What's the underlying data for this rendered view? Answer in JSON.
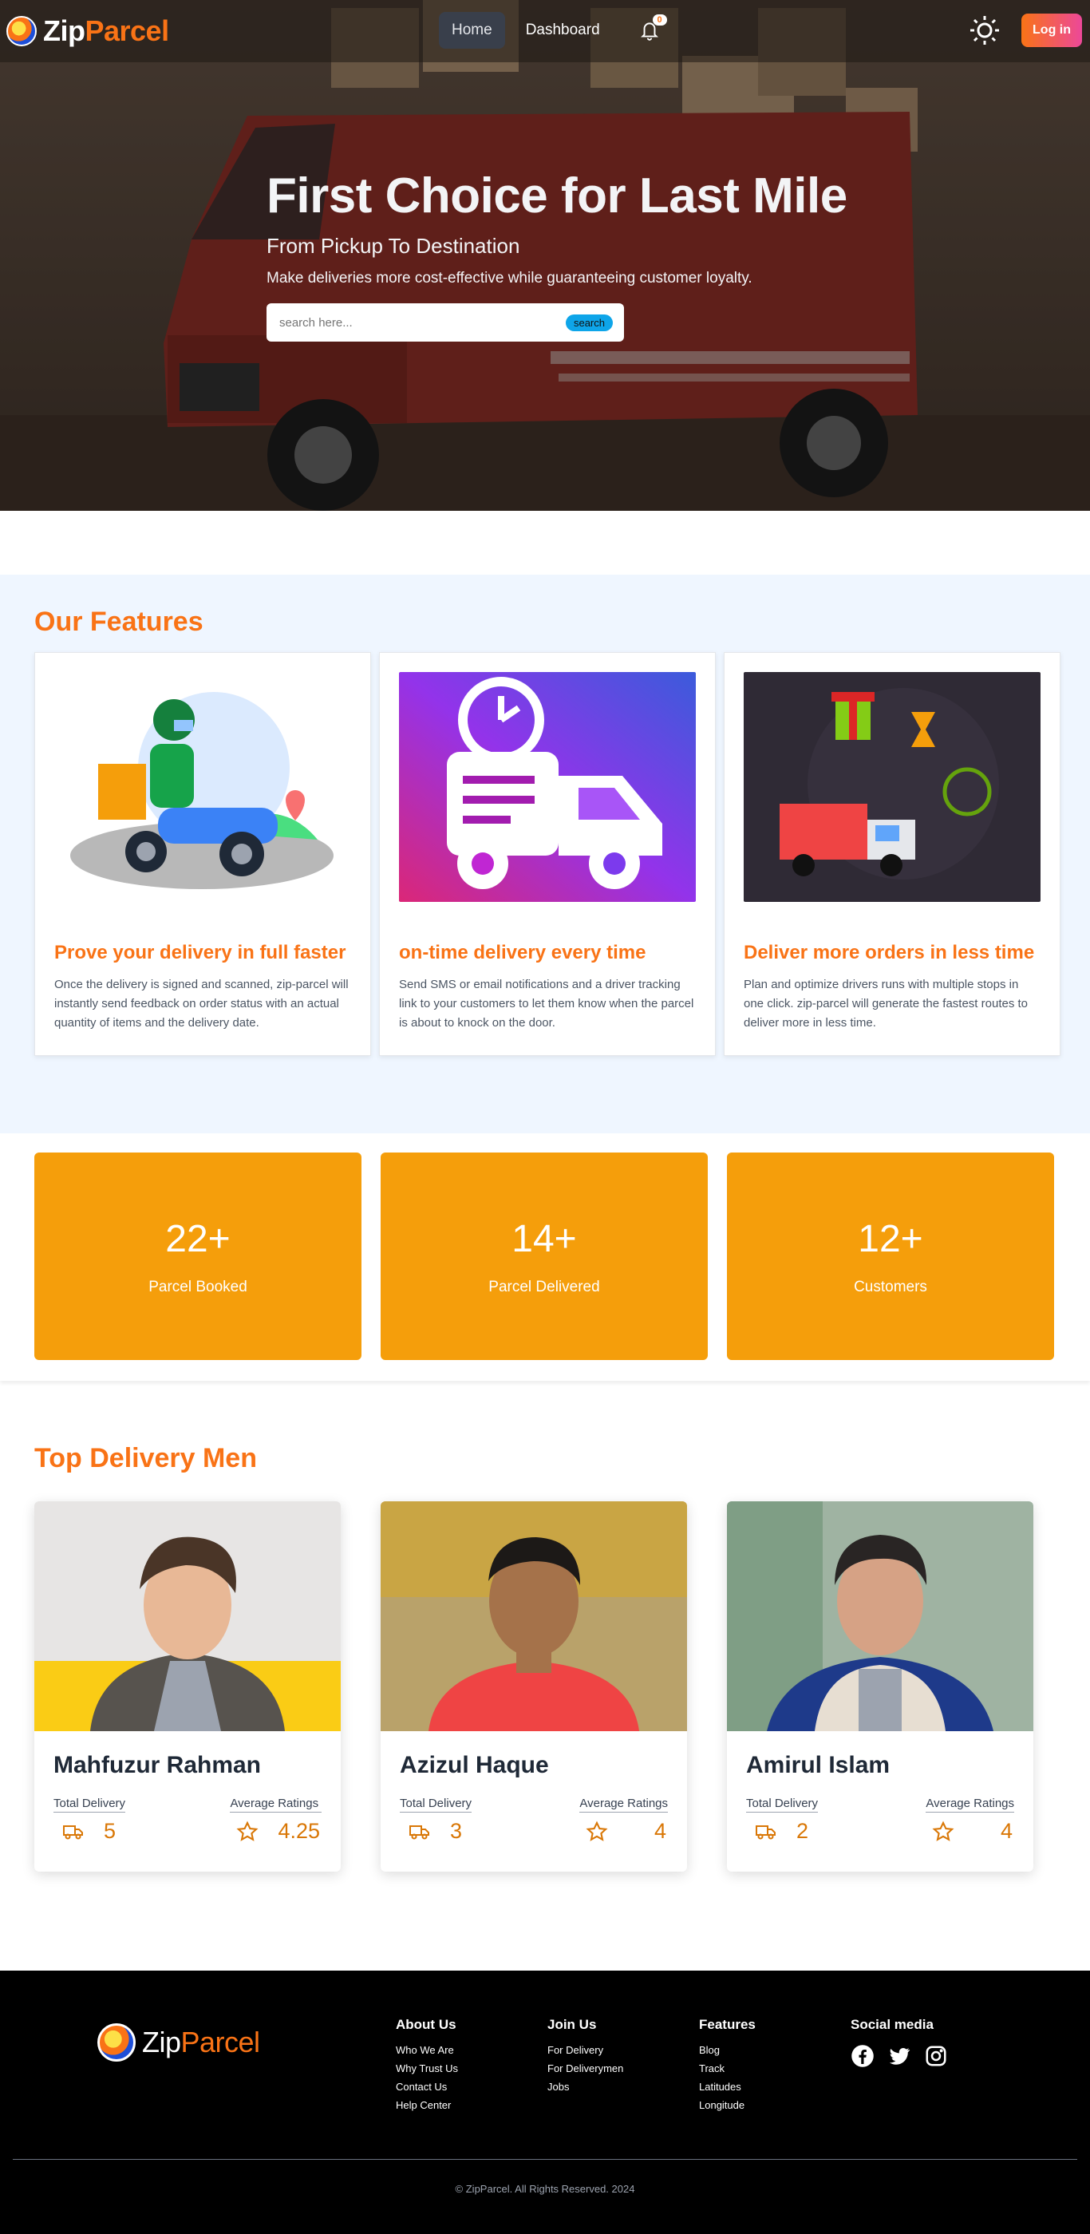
{
  "nav": {
    "brand_zip": "Zip",
    "brand_parcel": "Parcel",
    "home": "Home",
    "dashboard": "Dashboard",
    "notification_count": "0",
    "login": "Log in"
  },
  "hero": {
    "title": "First Choice for Last Mile",
    "subtitle": "From Pickup To Destination",
    "description": "Make deliveries more cost-effective while guaranteeing customer loyalty.",
    "search_placeholder": "search here...",
    "search_button": "search"
  },
  "features": {
    "title": "Our Features",
    "items": [
      {
        "title": "Prove your delivery in full faster",
        "text": "Once the delivery is signed and scanned, zip-parcel will instantly send feedback on order status with an actual quantity of items and the delivery date."
      },
      {
        "title": "on-time delivery every time",
        "text": "Send SMS or email notifications and a driver tracking link to your customers to let them know when the parcel is about to knock on the door."
      },
      {
        "title": "Deliver more orders in less time",
        "text": "Plan and optimize drivers runs with multiple stops in one click. zip-parcel will generate the fastest routes to deliver more in less time."
      }
    ]
  },
  "stats": [
    {
      "value": "22",
      "suffix": "+",
      "label": "Parcel Booked"
    },
    {
      "value": "14",
      "suffix": "+",
      "label": "Parcel Delivered"
    },
    {
      "value": "12",
      "suffix": "+",
      "label": "Customers"
    }
  ],
  "deliverymen": {
    "title": "Top Delivery Men",
    "total_label": "Total Delivery",
    "rating_label": "Average Ratings",
    "items": [
      {
        "name": "Mahfuzur Rahman",
        "total": "5",
        "rating": "4.25"
      },
      {
        "name": "Azizul Haque",
        "total": "3",
        "rating": "4"
      },
      {
        "name": "Amirul Islam",
        "total": "2",
        "rating": "4"
      }
    ]
  },
  "footer": {
    "brand_zip": "Zip",
    "brand_parcel": "Parcel",
    "columns": [
      {
        "title": "About Us",
        "links": [
          "Who We Are",
          "Why Trust Us",
          "Contact Us",
          "Help Center"
        ]
      },
      {
        "title": "Join Us",
        "links": [
          "For Delivery",
          "For Deliverymen",
          "Jobs"
        ]
      },
      {
        "title": "Features",
        "links": [
          "Blog",
          "Track",
          "Latitudes",
          "Longitude"
        ]
      }
    ],
    "social_title": "Social media",
    "copyright": "© ZipParcel. All Rights Reserved. 2024"
  },
  "colors": {
    "accent": "#f97316",
    "stat_card": "#f59e0b",
    "features_bg": "#eff6ff",
    "footer_bg": "#000000"
  }
}
